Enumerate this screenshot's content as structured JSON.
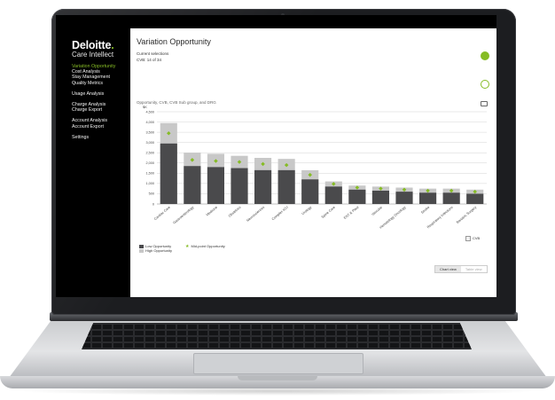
{
  "sidebar": {
    "brand_name": "Deloitte",
    "brand_dot": ".",
    "product": "Care Intellect",
    "nav_groups": [
      [
        "Variation Opportunity",
        "Cost Analysis",
        "Stay Management",
        "Quality Metrics"
      ],
      [
        "Usage Analysis"
      ],
      [
        "Charge Analysis",
        "Charge Export"
      ],
      [
        "Account Analysis",
        "Account Export"
      ],
      [
        "Settings"
      ]
    ],
    "active_item": "Variation Opportunity"
  },
  "header": {
    "title": "Variation Opportunity",
    "current_selections_label": "Current selections",
    "current_selections_value": "CVB: 14 of 34"
  },
  "chart_data": {
    "type": "bar",
    "title": "Opportunity, CVB, CVB Sub group, and DRG",
    "ylabel": "$K",
    "ylim": [
      0,
      4500
    ],
    "yticks": [
      0,
      500,
      1000,
      1500,
      2000,
      2500,
      3000,
      3500,
      4000,
      4500
    ],
    "ytick_labels": [
      "0",
      "500",
      "1,000",
      "1,500",
      "2,000",
      "2,500",
      "3,000",
      "3,500",
      "4,000",
      "4,500"
    ],
    "grid": true,
    "categories": [
      "Cardiac Care",
      "Gastroenterology",
      "Medicine",
      "Obstetrics",
      "Neurosciences",
      "Complex ICU",
      "Urology",
      "Spine Care",
      "ENT & Plast",
      "Vascular",
      "Hematology Oncology",
      "Stroke",
      "Respiratory Infections",
      "Bariatric Surgery"
    ],
    "series": [
      {
        "name": "Low Opportunity",
        "color": "#4a4a4c",
        "values": [
          2950,
          1850,
          1800,
          1750,
          1650,
          1650,
          1200,
          850,
          700,
          650,
          600,
          550,
          550,
          500
        ]
      },
      {
        "name": "High Opportunity",
        "color": "#c8c8c8",
        "values": [
          3950,
          2500,
          2450,
          2350,
          2250,
          2200,
          1650,
          1100,
          900,
          850,
          800,
          750,
          750,
          700
        ]
      },
      {
        "name": "Mid-point Opportunity",
        "color": "#86bc25",
        "values": [
          3450,
          2150,
          2100,
          2050,
          1950,
          1900,
          1420,
          980,
          800,
          750,
          700,
          650,
          650,
          600
        ]
      }
    ]
  },
  "export_label": "CVB",
  "view_toggle": {
    "chart": "Chart view",
    "table": "Table view"
  },
  "colors": {
    "accent": "#86bc25",
    "low": "#4a4a4c",
    "high": "#c8c8c8"
  }
}
